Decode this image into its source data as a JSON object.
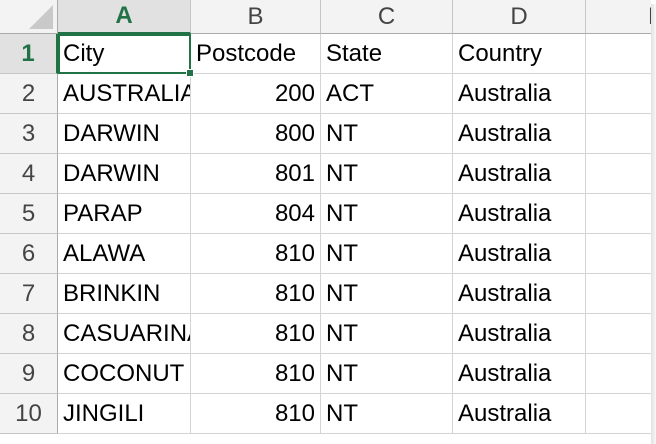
{
  "spreadsheet": {
    "columns": [
      "A",
      "B",
      "C",
      "D",
      "E"
    ],
    "selected_cell": "A1",
    "rows": [
      {
        "num": "1",
        "city": "City",
        "postcode": "Postcode",
        "state": "State",
        "country": "Country"
      },
      {
        "num": "2",
        "city": "AUSTRALIA",
        "postcode": "200",
        "state": "ACT",
        "country": "Australia"
      },
      {
        "num": "3",
        "city": "DARWIN",
        "postcode": "800",
        "state": "NT",
        "country": "Australia"
      },
      {
        "num": "4",
        "city": "DARWIN",
        "postcode": "801",
        "state": "NT",
        "country": "Australia"
      },
      {
        "num": "5",
        "city": "PARAP",
        "postcode": "804",
        "state": "NT",
        "country": "Australia"
      },
      {
        "num": "6",
        "city": "ALAWA",
        "postcode": "810",
        "state": "NT",
        "country": "Australia"
      },
      {
        "num": "7",
        "city": "BRINKIN",
        "postcode": "810",
        "state": "NT",
        "country": "Australia"
      },
      {
        "num": "8",
        "city": "CASUARINA",
        "postcode": "810",
        "state": "NT",
        "country": "Australia"
      },
      {
        "num": "9",
        "city": "COCONUT",
        "postcode": "810",
        "state": "NT",
        "country": "Australia"
      },
      {
        "num": "10",
        "city": "JINGILI",
        "postcode": "810",
        "state": "NT",
        "country": "Australia"
      }
    ]
  },
  "colors": {
    "accent": "#217346",
    "header_bg": "#f3f3f3",
    "active_header_bg": "#e1e1e1",
    "gridline": "#d4d4d4"
  }
}
